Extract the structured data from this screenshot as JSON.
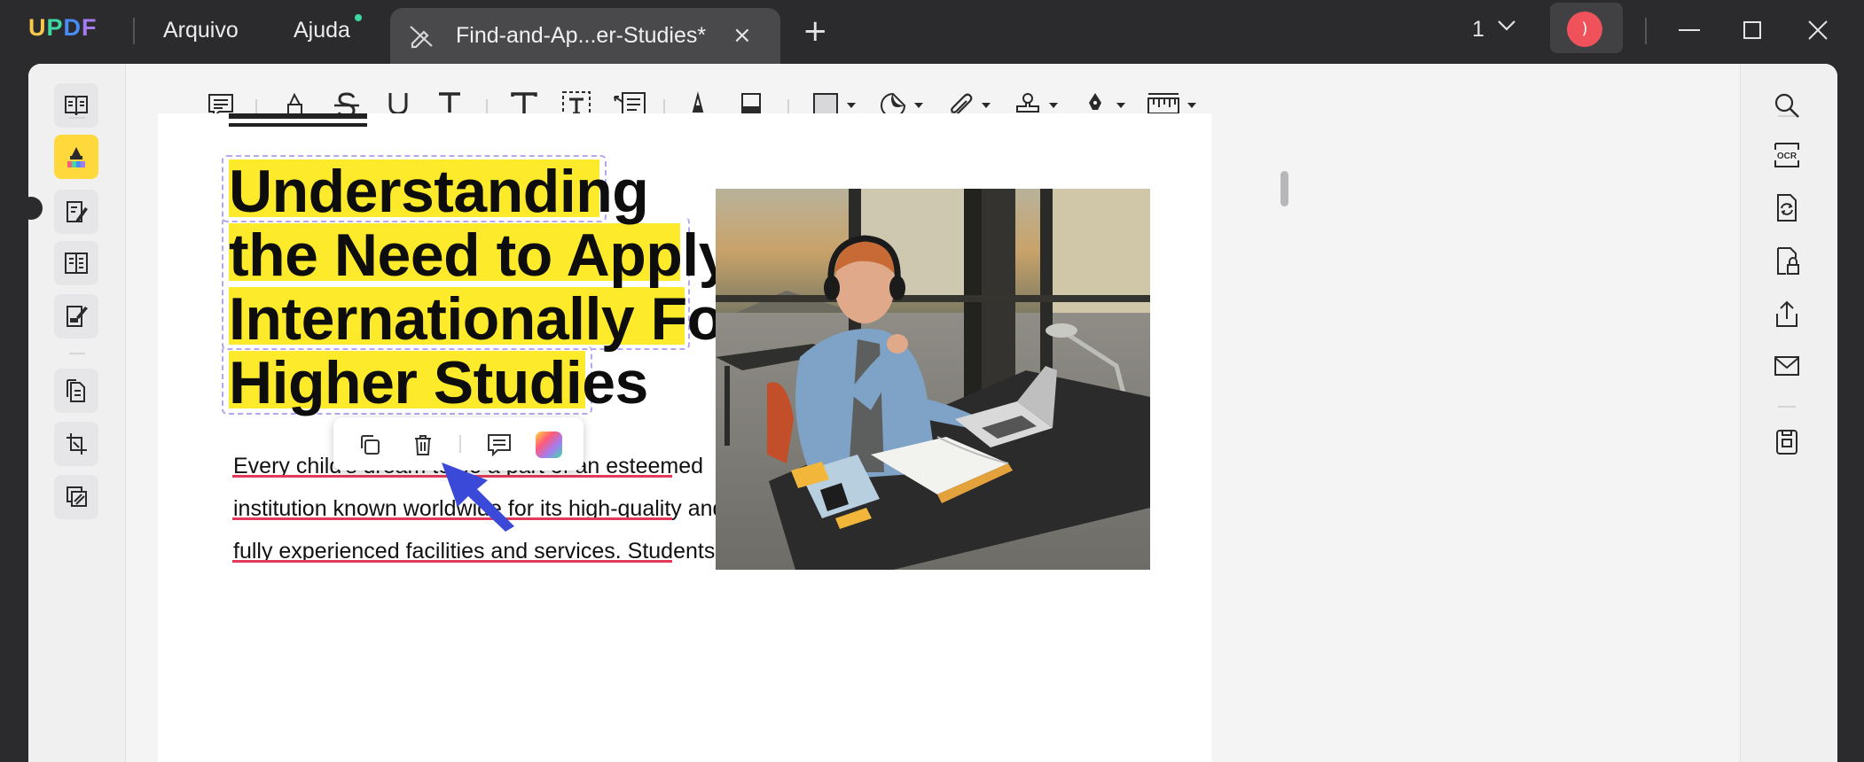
{
  "app": {
    "logo": "UPDF",
    "logo_colors": [
      "#f8c94b",
      "#3ed9a3",
      "#4a8cf7",
      "#a57cf0"
    ],
    "menus": [
      "Arquivo",
      "Ajuda"
    ],
    "tab_title": "Find-and-Ap...er-Studies*",
    "page_indicator": "1",
    "avatar_letter": ")"
  },
  "toolbar": {
    "icons": [
      "comment-icon",
      "highlight-icon",
      "strikethrough-icon",
      "underline-icon",
      "squiggly-icon",
      "text-icon",
      "textbox-icon",
      "text-callout-icon",
      "pencil-icon",
      "eraser-icon",
      "shape-icon",
      "sticker-icon",
      "attachment-icon",
      "stamp-icon",
      "signature-icon",
      "measure-icon"
    ]
  },
  "left_sidebar": {
    "icons": [
      "reader-icon",
      "comment-mode-icon",
      "edit-pdf-icon",
      "organize-pages-icon",
      "form-icon",
      "page-tools-icon",
      "crop-icon",
      "redact-icon"
    ],
    "active": "comment-mode-icon"
  },
  "right_sidebar": {
    "icons": [
      "search-icon",
      "ocr-icon",
      "convert-icon",
      "protect-icon",
      "share-icon",
      "email-icon",
      "save-icon"
    ],
    "ocr_label": "OCR"
  },
  "document": {
    "headline_lines": [
      "Understanding",
      "the Need to Apply",
      "Internationally For",
      "Higher Studies"
    ],
    "highlight_color": "#fdea2a",
    "body_lines": [
      "Every child's dream to be a part of an esteemed",
      "institution known worldwide for its high-quality and",
      "fully experienced facilities and services. Students"
    ],
    "underline_color": "#e23b5a"
  },
  "popup": {
    "icons": [
      "copy-icon",
      "delete-icon",
      "comment-icon",
      "color-picker-icon"
    ]
  },
  "colors": {
    "titlebar": "#2b2b2d",
    "accent": "#9a7cf0",
    "arrow": "#3a49d8"
  }
}
